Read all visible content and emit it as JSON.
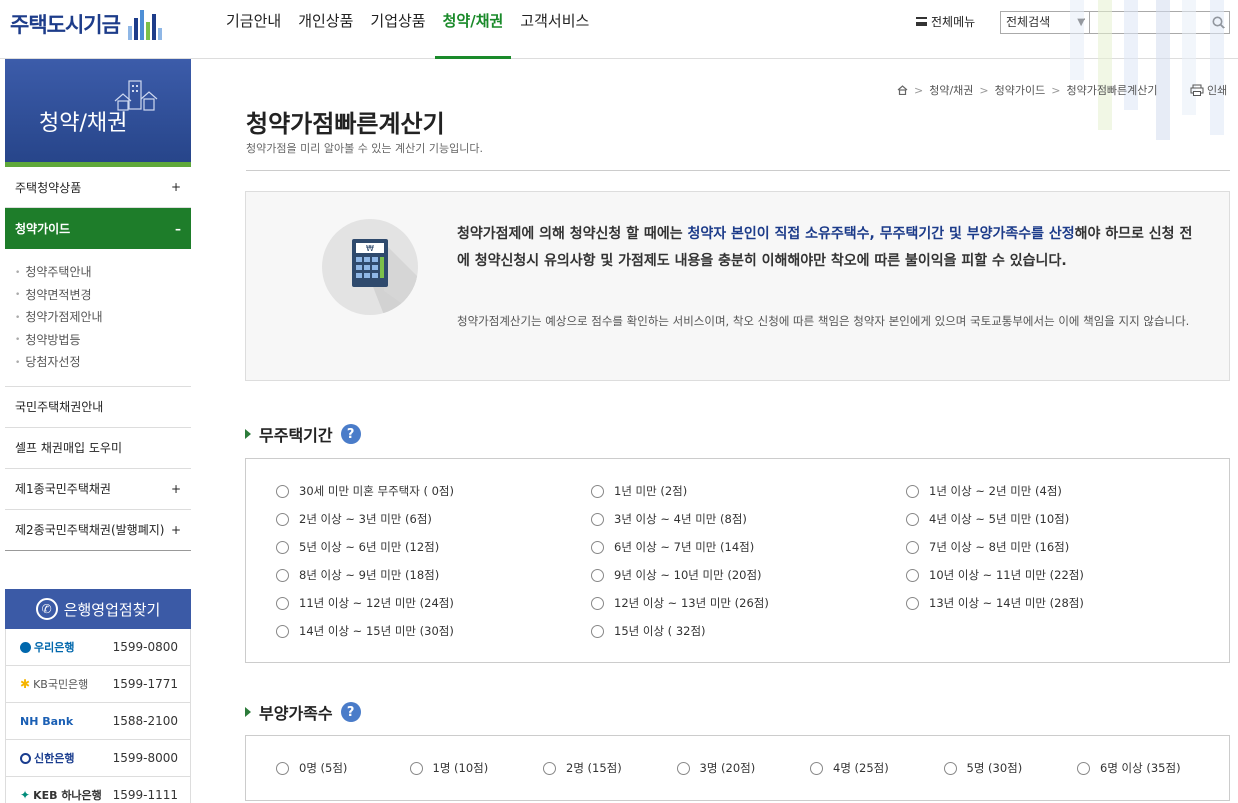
{
  "header": {
    "logo_text": "주택도시기금",
    "nav": [
      "기금안내",
      "개인상품",
      "기업상품",
      "청약/채권",
      "고객서비스"
    ],
    "active_nav": "청약/채권",
    "allmenu_label": "전체메뉴",
    "search_scope": "전체검색",
    "search_value": ""
  },
  "sidebar": {
    "banner_title": "청약/채권",
    "items": [
      {
        "label": "주택청약상품",
        "toggle": "+"
      },
      {
        "label": "청약가이드",
        "toggle": "–"
      }
    ],
    "sub_items": [
      "청약주택안내",
      "청약면적변경",
      "청약가점제안내",
      "청약방법등",
      "당첨자선정"
    ],
    "items_after": [
      {
        "label": "국민주택채권안내",
        "toggle": ""
      },
      {
        "label": "셀프 채권매입 도우미",
        "toggle": ""
      },
      {
        "label": "제1종국민주택채권",
        "toggle": "+"
      },
      {
        "label": "제2종국민주택채권(발행폐지)",
        "toggle": "+"
      }
    ]
  },
  "banks": {
    "title": "은행영업점찾기",
    "rows": [
      {
        "name": "우리은행",
        "phone": "1599-0800",
        "color": "#0067ac"
      },
      {
        "name": "KB국민은행",
        "phone": "1599-1771",
        "color": "#7a6a50"
      },
      {
        "name": "NH Bank",
        "phone": "1588-2100",
        "color": "#1a5fb4"
      },
      {
        "name": "신한은행",
        "phone": "1599-8000",
        "color": "#1a3d8f"
      },
      {
        "name": "KEB 하나은행",
        "phone": "1599-1111",
        "color": "#008c7a"
      }
    ]
  },
  "breadcrumb": [
    "청약/채권",
    "청약가이드",
    "청약가점빠른계산기"
  ],
  "print_label": "인쇄",
  "page": {
    "title": "청약가점빠른계산기",
    "desc": "청약가점을 미리 알아볼 수 있는 계산기 기능입니다."
  },
  "notice": {
    "main_1": "청약가점제에 의해 청약신청 할 때에는 ",
    "main_hl": "청약자 본인이 직접 소유주택수, 무주택기간 및 부양가족수를 산정",
    "main_2": "해야 하므로 신청 전에 청약신청시 유의사항 및 가점제도 내용을 충분히 이해해야만 착오에 따른 불이익을 피할 수 있습니다.",
    "sub": "청약가점계산기는 예상으로 점수를 확인하는 서비스이며, 착오 신청에 따른 책임은 청약자 본인에게 있으며 국토교통부에서는 이에 책임을 지지 않습니다."
  },
  "sections": {
    "period": {
      "title": "무주택기간",
      "options": [
        "30세 미만 미혼 무주택자 ( 0점)",
        "1년 미만 (2점)",
        "1년 이상 ~ 2년 미만 (4점)",
        "2년 이상 ~ 3년 미만 (6점)",
        "3년 이상 ~ 4년 미만 (8점)",
        "4년 이상 ~ 5년 미만 (10점)",
        "5년 이상 ~ 6년 미만 (12점)",
        "6년 이상 ~ 7년 미만 (14점)",
        "7년 이상 ~ 8년 미만 (16점)",
        "8년 이상 ~ 9년 미만 (18점)",
        "9년 이상 ~ 10년 미만 (20점)",
        "10년 이상 ~ 11년 미만 (22점)",
        "11년 이상 ~ 12년 미만 (24점)",
        "12년 이상 ~ 13년 미만 (26점)",
        "13년 이상 ~ 14년 미만 (28점)",
        "14년 이상 ~ 15년 미만 (30점)",
        "15년 이상 ( 32점)"
      ]
    },
    "family": {
      "title": "부양가족수",
      "options": [
        "0명 (5점)",
        "1명 (10점)",
        "2명 (15점)",
        "3명 (20점)",
        "4명 (25점)",
        "5명 (30점)",
        "6명 이상 (35점)"
      ]
    }
  },
  "colors": {
    "brand_blue": "#1d3c8a",
    "brand_green": "#1a8a2a",
    "side_active": "#1e7d2a",
    "bank_head": "#3b5aa6"
  }
}
